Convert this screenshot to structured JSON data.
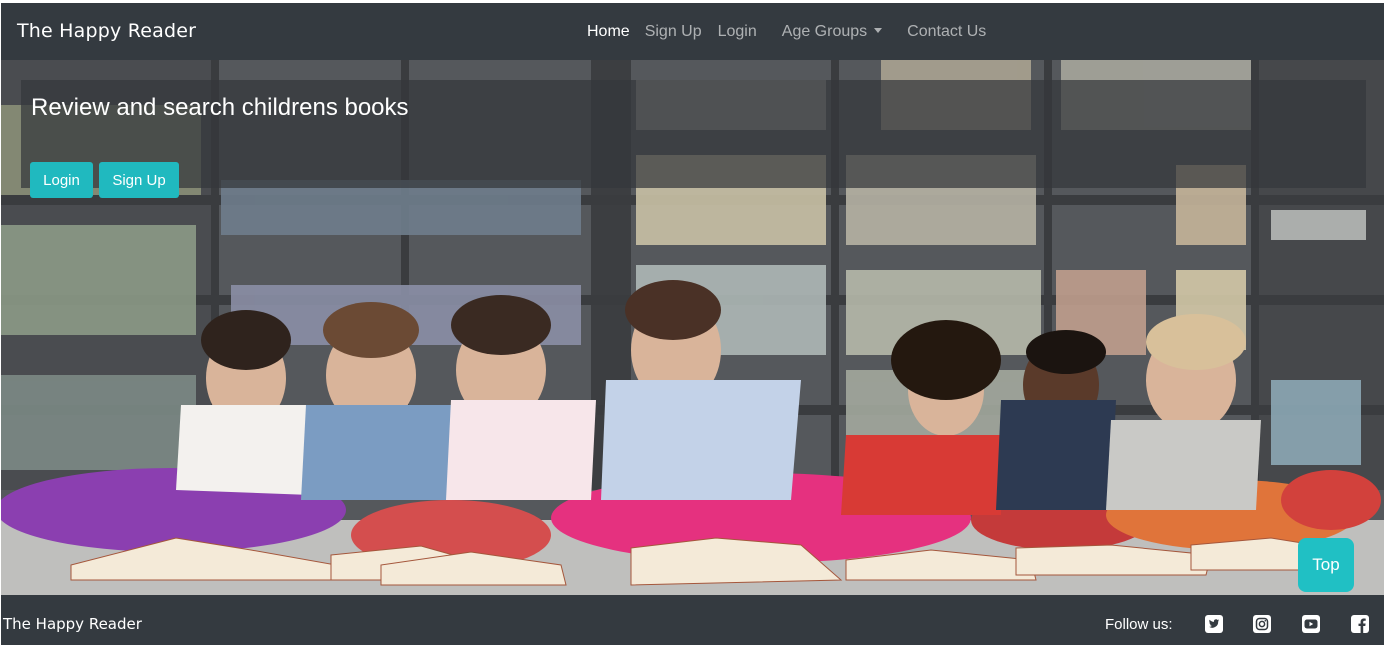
{
  "navbar": {
    "brand": "The Happy Reader",
    "links": {
      "home": "Home",
      "sign_up": "Sign Up",
      "login": "Login",
      "age_groups": "Age Groups",
      "contact_us": "Contact Us"
    }
  },
  "hero": {
    "heading": "Review and search childrens books",
    "login_button": "Login",
    "signup_button": "Sign Up",
    "image_icon": "children-reading-library-photo"
  },
  "back_to_top": {
    "label": "Top"
  },
  "footer": {
    "brand": "The Happy Reader",
    "follow_label": "Follow us:",
    "social_icons": [
      "twitter-icon",
      "instagram-icon",
      "youtube-icon",
      "facebook-icon"
    ]
  },
  "colors": {
    "navbar_bg": "#343a40",
    "accent": "#20b9bf",
    "text_muted": "rgba(255,255,255,0.6)"
  }
}
